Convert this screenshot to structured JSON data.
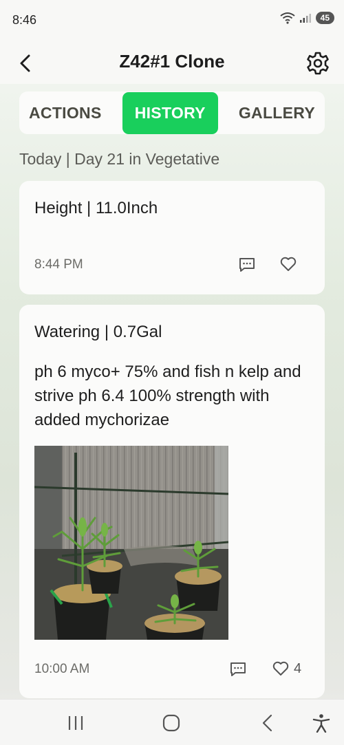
{
  "status_bar": {
    "time": "8:46",
    "battery": "45",
    "icons": [
      "wifi-icon",
      "signal-icon",
      "battery-icon"
    ]
  },
  "header": {
    "title": "Z42#1 Clone",
    "back_icon": "chevron-left-icon",
    "settings_icon": "gear-icon"
  },
  "tabs": [
    {
      "label": "ACTIONS",
      "active": false
    },
    {
      "label": "HISTORY",
      "active": true
    },
    {
      "label": "GALLERY",
      "active": false
    }
  ],
  "day_label": "Today | Day 21 in Vegetative",
  "entries": [
    {
      "title": "Height | 11.0Inch",
      "note": "",
      "time": "8:44 PM",
      "likes": ""
    },
    {
      "title": "Watering | 0.7Gal",
      "note": "ph 6 myco+ 75% and fish n kelp and strive ph 6.4 100% strength with added mychorizae",
      "time": "10:00 AM",
      "likes": "4",
      "has_photo": true
    }
  ],
  "colors": {
    "accent": "#19cf5c",
    "card": "#fbfbfa"
  },
  "nav": [
    "recent-apps-icon",
    "home-icon",
    "back-icon",
    "accessibility-icon"
  ]
}
